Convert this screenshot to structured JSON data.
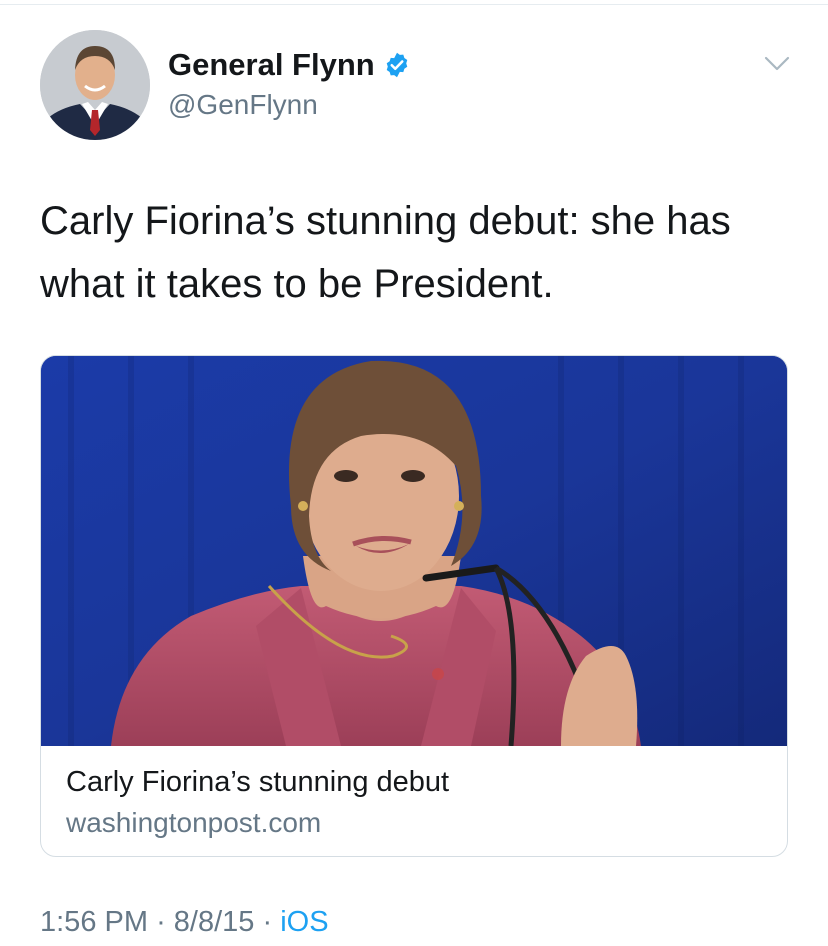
{
  "tweet": {
    "author": {
      "display_name": "General Flynn",
      "handle": "@GenFlynn",
      "verified": true
    },
    "text": "Carly Fiorina’s stunning debut: she has what it takes to be President.",
    "card": {
      "title": "Carly Fiorina’s stunning debut",
      "domain": "washingtonpost.com"
    },
    "meta": {
      "time": "1:56 PM",
      "separator": "·",
      "date": "8/8/15",
      "source": "iOS"
    }
  },
  "colors": {
    "primary_text": "#14171a",
    "secondary_text": "#657786",
    "link_blue": "#1da1f2",
    "verified_blue": "#1da1f2",
    "card_border": "#d5dde3"
  },
  "icons": {
    "verified": "verified-badge-icon",
    "menu": "chevron-down-icon"
  }
}
